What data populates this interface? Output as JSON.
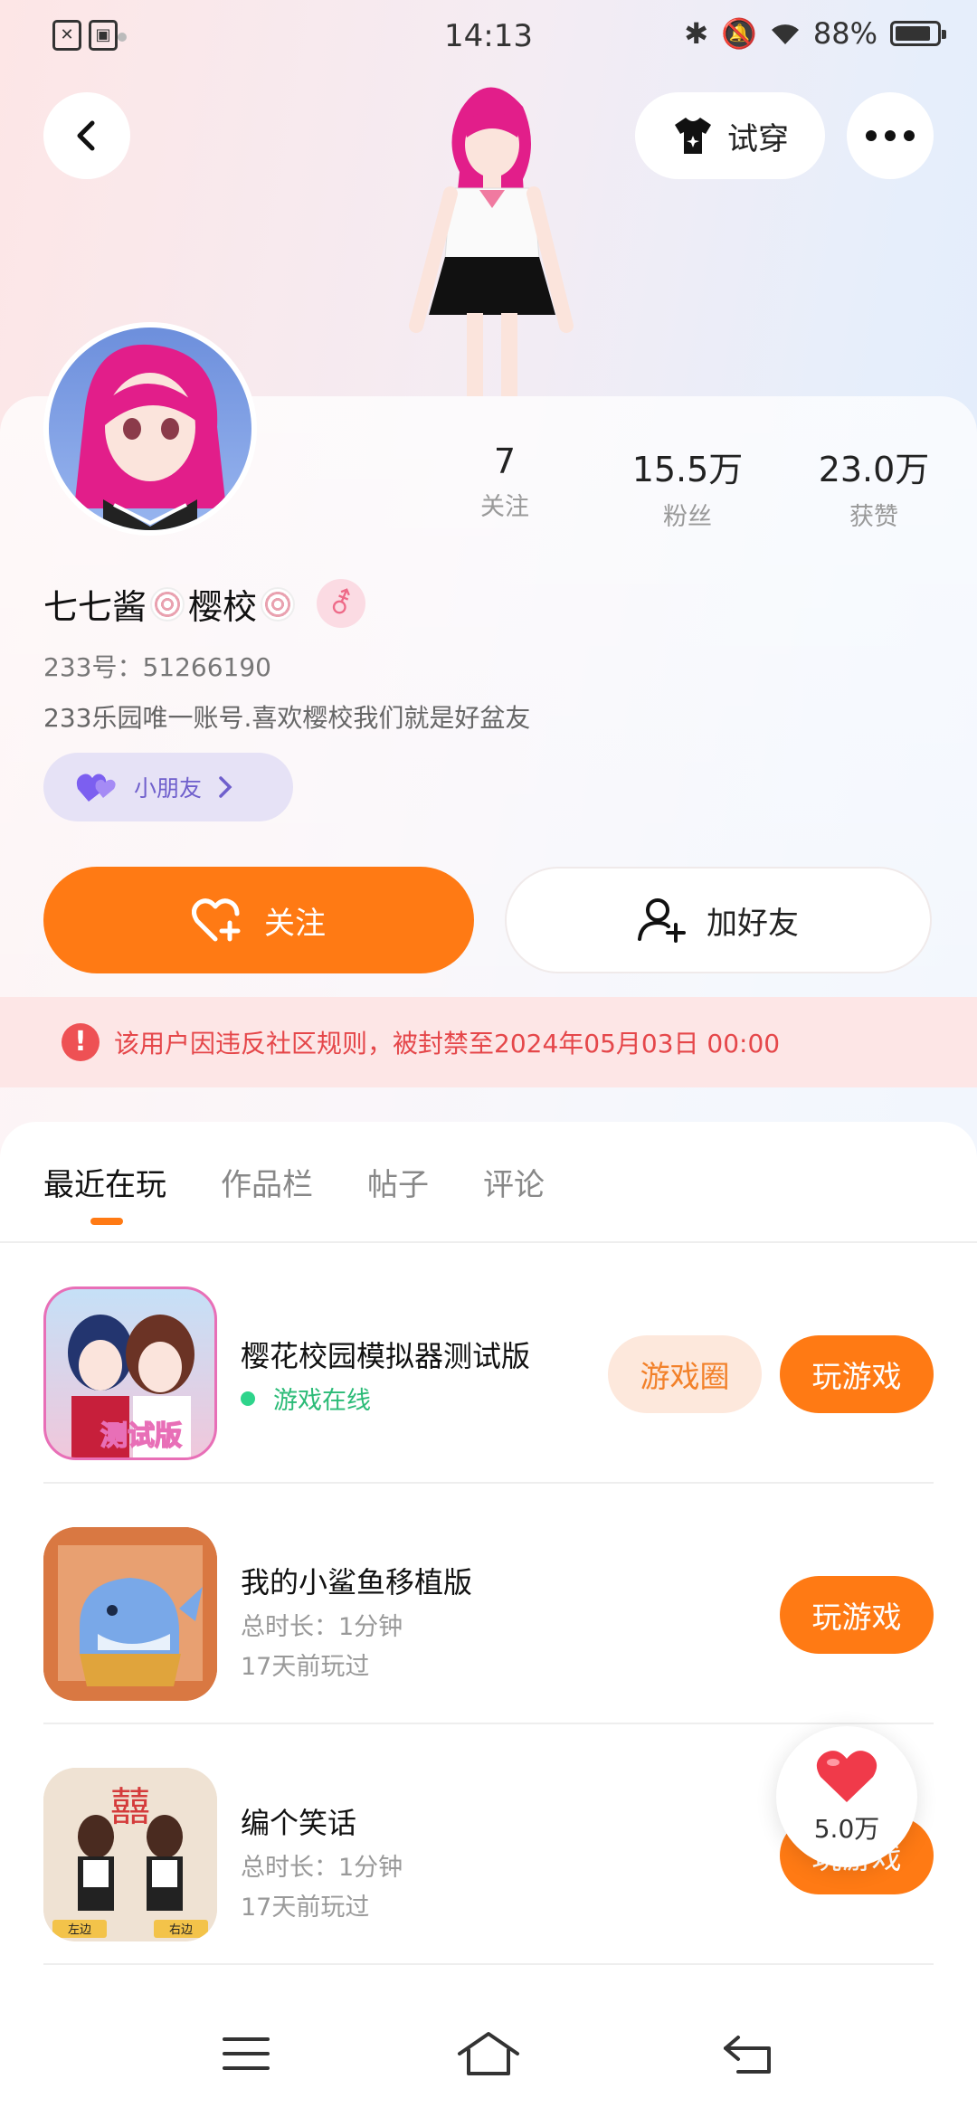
{
  "status": {
    "time": "14:13",
    "battery": "88%",
    "battery_level": 0.88
  },
  "header": {
    "try_on_label": "试穿"
  },
  "profile": {
    "stats": [
      {
        "num": "7",
        "label": "关注"
      },
      {
        "num": "15.5万",
        "label": "粉丝"
      },
      {
        "num": "23.0万",
        "label": "获赞"
      }
    ],
    "name_part1": "七七酱",
    "name_part2": "樱校",
    "gender_symbol": "⚦",
    "uid": "233号：51266190",
    "bio": "233乐园唯一账号.喜欢樱校我们就是好盆友",
    "friend_tag": "小朋友"
  },
  "actions": {
    "follow": "关注",
    "add_friend": "加好友"
  },
  "ban_notice": "该用户因违反社区规则，被封禁至2024年05月03日 00:00",
  "tabs": [
    "最近在玩",
    "作品栏",
    "帖子",
    "评论"
  ],
  "games": [
    {
      "title": "樱花校园模拟器测试版",
      "status": "游戏在线",
      "circle_label": "游戏圈",
      "play_label": "玩游戏",
      "badge": "测试版"
    },
    {
      "title": "我的小鲨鱼移植版",
      "duration": "总时长：1分钟",
      "last_played": "17天前玩过",
      "play_label": "玩游戏"
    },
    {
      "title": "编个笑话",
      "duration": "总时长：1分钟",
      "last_played": "17天前玩过",
      "play_label": "玩游戏",
      "sign_left": "左边",
      "sign_right": "右边",
      "banner": "囍"
    }
  ],
  "likes_float": "5.0万",
  "colors": {
    "accent": "#ff7a14",
    "ban_red": "#e5474a",
    "online_green": "#2ed48b",
    "friend_purple": "#6f5fcc"
  }
}
